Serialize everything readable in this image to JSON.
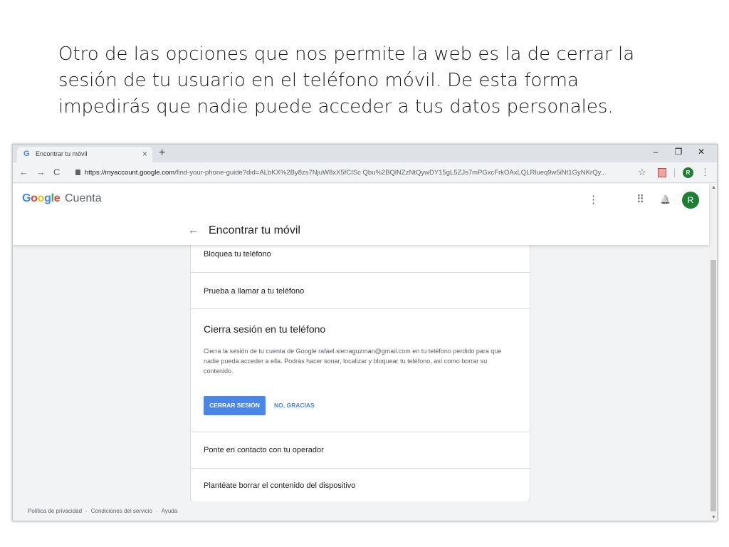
{
  "slide": {
    "text": "Otro de las opciones que nos permite la web es la de cerrar la\nsesión de tu usuario en el teléfono móvil. De esta forma\nimpedirás que nadie puede acceder a tus datos personales."
  },
  "browser": {
    "tab_favicon": "G",
    "tab_title": "Encontrar tu móvil",
    "tab_close": "×",
    "new_tab": "+",
    "window_controls": {
      "minimize": "–",
      "restore": "❐",
      "close": "✕"
    },
    "nav": {
      "back": "←",
      "forward": "→",
      "reload": "C"
    },
    "url_host": "https://myaccount.google.com",
    "url_path": "/find-your-phone-guide?did=ALbKX%2By8zs7NjuW8xX5fCISc Qbu%2BQlNZzNtQywDY15gL5ZJs7mPGxcFrkOAxLQLRlueq9w5iNt1GyNKrQy...",
    "star": "☆",
    "profile_initial": "R",
    "menu": "⋮"
  },
  "header": {
    "logo_letters": [
      {
        "char": "G",
        "color": "#4285f4"
      },
      {
        "char": "o",
        "color": "#ea4335"
      },
      {
        "char": "o",
        "color": "#fbbc05"
      },
      {
        "char": "g",
        "color": "#4285f4"
      },
      {
        "char": "l",
        "color": "#34a853"
      },
      {
        "char": "e",
        "color": "#ea4335"
      }
    ],
    "logo_suffix": "Cuenta",
    "more_icon": "⋮",
    "apps_icon": "⠿",
    "bell_icon": "🔔",
    "avatar_initial": "R",
    "back_arrow": "←",
    "page_title": "Encontrar tu móvil"
  },
  "card": {
    "row_lock": "Bloquea tu teléfono",
    "row_call": "Prueba a llamar a tu teléfono",
    "signout_title": "Cierra sesión en tu teléfono",
    "signout_desc": "Cierra la sesión de tu cuenta de Google rafael.sierraguzman@gmail.com en tu teléfono perdido para que nadie pueda acceder a ella. Podrás hacer sonar, localizar y bloquear tu teléfono, así como borrar su contenido.",
    "signout_button": "CERRAR SESIÓN",
    "decline_button": "NO, GRACIAS",
    "row_operator": "Ponte en contacto con tu operador",
    "row_erase": "Plantéate borrar el contenido del dispositivo"
  },
  "footer": {
    "privacy": "Política de privacidad",
    "terms": "Condiciones del servicio",
    "help": "Ayuda",
    "separator": "·"
  },
  "colors": {
    "accent_blue": "#4a86e8",
    "avatar_green": "#1e7e34"
  }
}
